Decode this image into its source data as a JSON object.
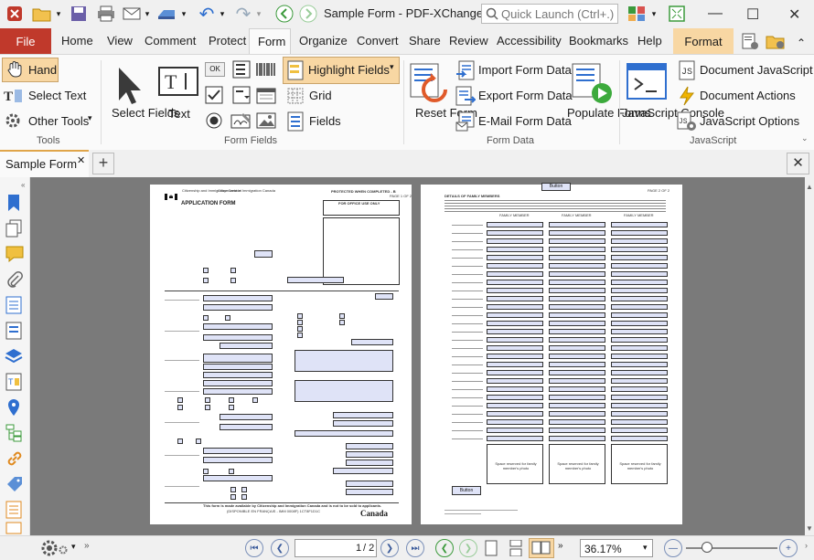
{
  "title_bar": {
    "document_title": "Sample Form - PDF-XChange E...",
    "quick_launch_placeholder": "Quick Launch (Ctrl+.)"
  },
  "menu_tabs": [
    "File",
    "Home",
    "View",
    "Comment",
    "Protect",
    "Form",
    "Organize",
    "Convert",
    "Share",
    "Review",
    "Accessibility",
    "Bookmarks",
    "Help",
    "Format"
  ],
  "active_tab": "Form",
  "ribbon": {
    "tools": {
      "hand": "Hand",
      "select_text": "Select Text",
      "other_tools": "Other Tools",
      "group": "Tools"
    },
    "form_fields": {
      "select_fields": "Select Fields",
      "text": "Text",
      "ok_label": "OK",
      "highlight_fields": "Highlight Fields",
      "grid": "Grid",
      "fields": "Fields",
      "group": "Form Fields"
    },
    "form_data": {
      "reset_form": "Reset Form",
      "import": "Import Form Data",
      "export": "Export Form Data",
      "email": "E-Mail Form Data",
      "populate": "Populate Forms",
      "group": "Form Data"
    },
    "javascript": {
      "console": "JavaScript Console",
      "doc_js": "Document JavaScript",
      "doc_actions": "Document Actions",
      "js_options": "JavaScript Options",
      "group": "JavaScript"
    }
  },
  "document_tab": {
    "name": "Sample Form"
  },
  "page1": {
    "agency": "Citizenship and Immigration Canada",
    "agency_fr": "Citoyenneté et Immigration Canada",
    "protected": "PROTECTED WHEN COMPLETED - B",
    "page_num": "PAGE 1 OF 2",
    "heading": "APPLICATION FORM",
    "office_use": "FOR OFFICE USE ONLY",
    "footer": "This form is made available by Citizenship and Immigration Canada and is not to be sold to applicants.",
    "footer2": "(DISPONIBLE EN FRANÇAIS - IMM 0008F) 1CT8F1D1C",
    "canada": "Canada"
  },
  "page2": {
    "button_top": "Button",
    "page_num": "PAGE 2 OF 2",
    "section": "DETAILS OF FAMILY MEMBERS",
    "column": "FAMILY MEMBER",
    "photo_text": "Space reserved for family member's photo",
    "button_bottom": "Button"
  },
  "status_bar": {
    "page_value": "1",
    "page_total": "/ 2",
    "zoom": "36.17%"
  }
}
